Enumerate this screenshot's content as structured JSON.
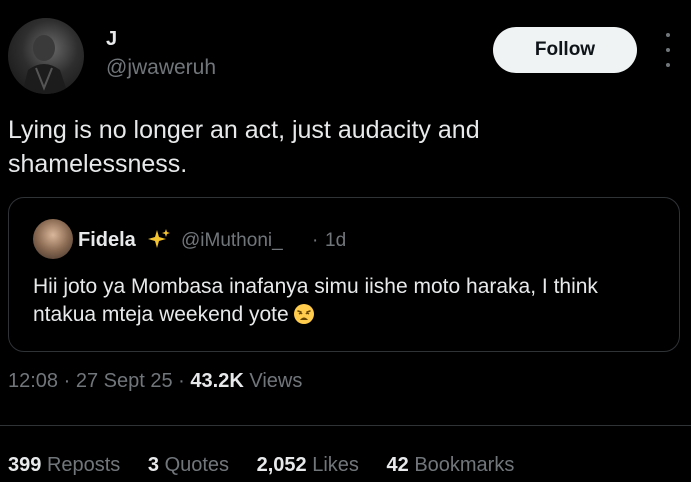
{
  "author": {
    "display_name": "J",
    "handle": "@jwaweruh"
  },
  "follow_label": "Follow",
  "tweet_text": "Lying is no longer an act, just audacity and shamelessness.",
  "quote": {
    "display_name": "Fidela",
    "handle": "@iMuthoni_",
    "separator": "·",
    "time": "1d",
    "text": "Hii joto ya Mombasa inafanya simu iishe moto haraka, I think ntakua mteja weekend yote"
  },
  "meta": {
    "time": "12:08",
    "sep1": "·",
    "date": "27 Sept 25",
    "sep2": "·",
    "views_count": "43.2K",
    "views_label": "Views"
  },
  "stats": {
    "reposts_count": "399",
    "reposts_label": "Reposts",
    "quotes_count": "3",
    "quotes_label": "Quotes",
    "likes_count": "2,052",
    "likes_label": "Likes",
    "bookmarks_count": "42",
    "bookmarks_label": "Bookmarks"
  },
  "colors": {
    "background": "#000000",
    "text": "#e7e9ea",
    "secondary_text": "#71767b",
    "border": "#2f3336",
    "follow_button_bg": "#eff3f4"
  },
  "icons": [
    "more-icon",
    "sparkle-icon",
    "weary-face-emoji"
  ]
}
